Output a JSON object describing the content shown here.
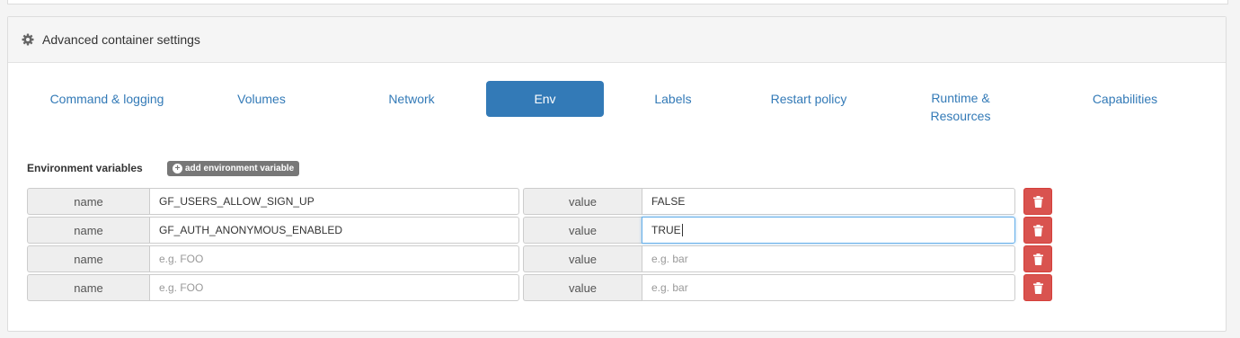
{
  "panel": {
    "title": "Advanced container settings"
  },
  "tabs": [
    {
      "label": "Command & logging",
      "active": false
    },
    {
      "label": "Volumes",
      "active": false
    },
    {
      "label": "Network",
      "active": false
    },
    {
      "label": "Env",
      "active": true
    },
    {
      "label": "Labels",
      "active": false
    },
    {
      "label": "Restart policy",
      "active": false
    },
    {
      "label": "Runtime & Resources",
      "active": false
    },
    {
      "label": "Capabilities",
      "active": false
    }
  ],
  "env": {
    "section_label": "Environment variables",
    "add_button_label": "add environment variable",
    "rows": [
      {
        "name_addon": "name",
        "name_value": "GF_USERS_ALLOW_SIGN_UP",
        "name_placeholder": "e.g. FOO",
        "value_addon": "value",
        "value_value": "FALSE",
        "value_placeholder": "e.g. bar"
      },
      {
        "name_addon": "name",
        "name_value": "GF_AUTH_ANONYMOUS_ENABLED",
        "name_placeholder": "e.g. FOO",
        "value_addon": "value",
        "value_value": "TRUE",
        "value_placeholder": "e.g. bar",
        "focused": "value"
      },
      {
        "name_addon": "name",
        "name_value": "",
        "name_placeholder": "e.g. FOO",
        "value_addon": "value",
        "value_value": "",
        "value_placeholder": "e.g. bar"
      },
      {
        "name_addon": "name",
        "name_value": "",
        "name_placeholder": "e.g. FOO",
        "value_addon": "value",
        "value_value": "",
        "value_placeholder": "e.g. bar"
      }
    ]
  },
  "colors": {
    "accent": "#337ab7",
    "danger": "#d9534f",
    "badge": "#777777"
  },
  "icons": {
    "header": "gear-icon",
    "add": "plus-circle-icon",
    "remove": "trash-icon"
  }
}
